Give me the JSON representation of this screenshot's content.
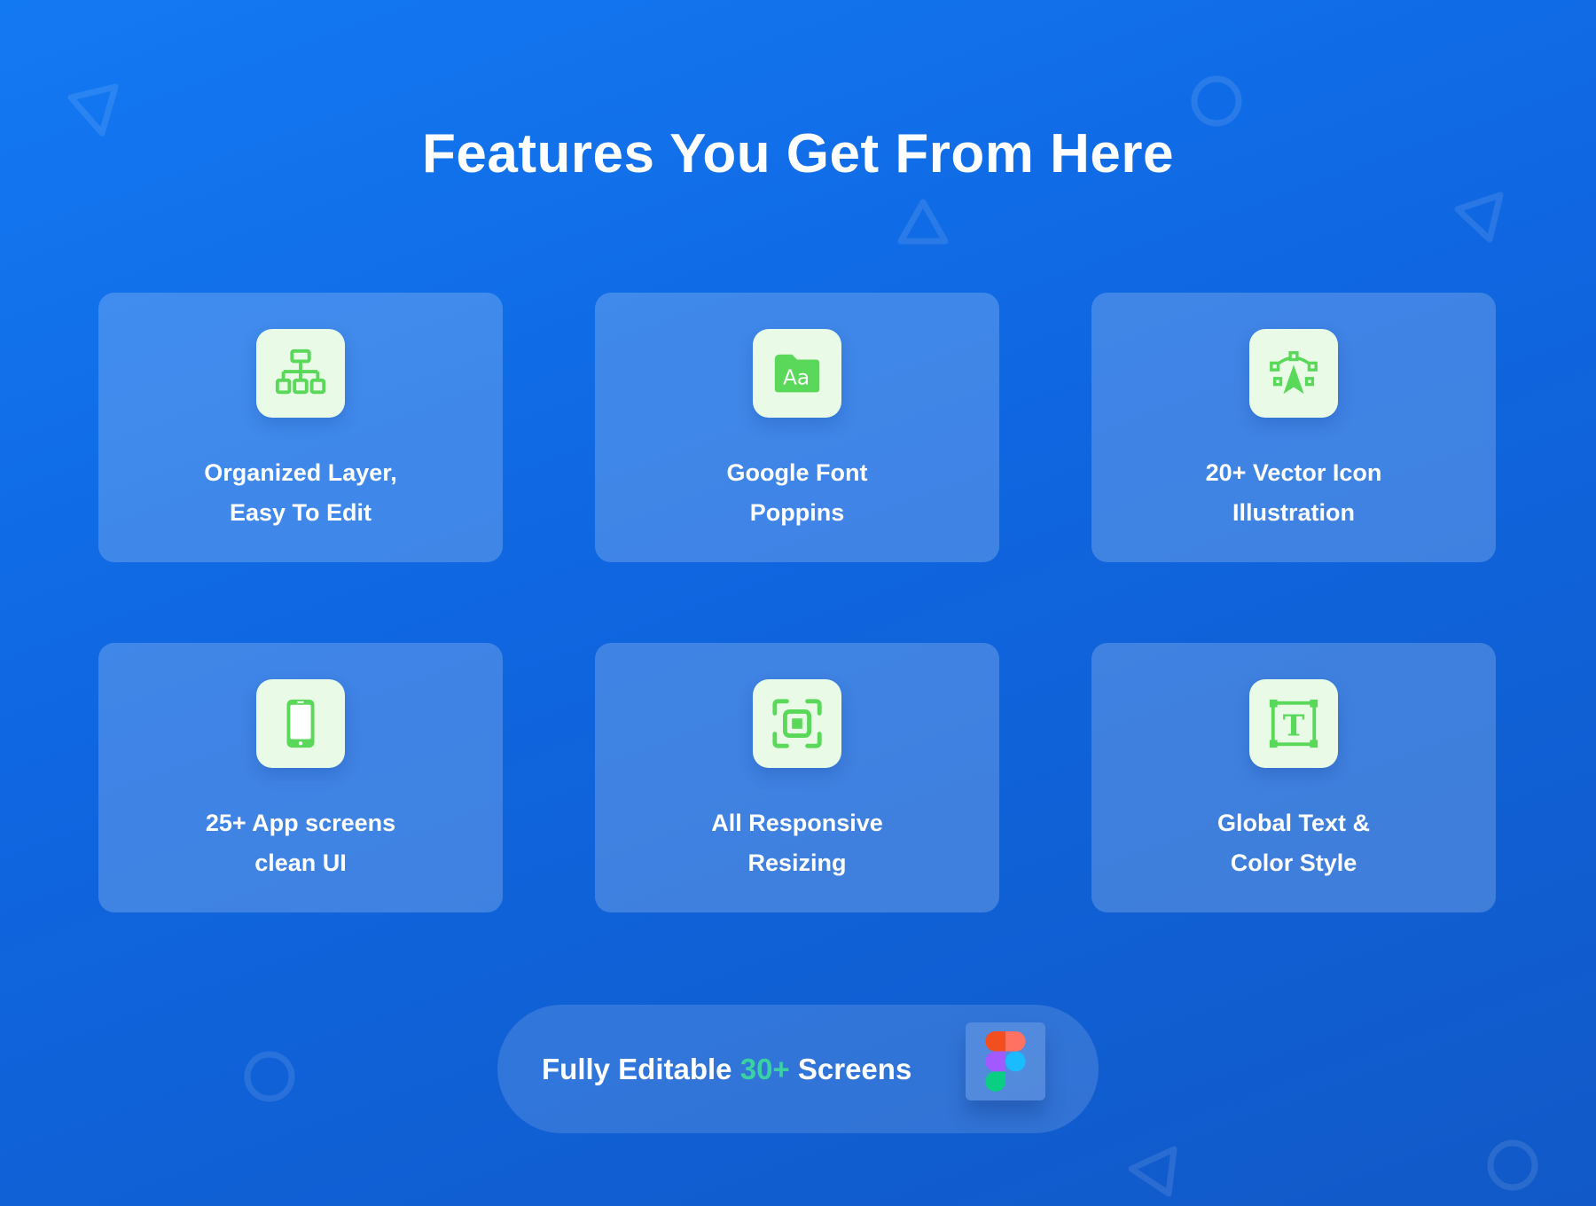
{
  "page": {
    "title": "Features You Get From Here"
  },
  "features": [
    {
      "icon": "sitemap-icon",
      "line1": "Organized Layer,",
      "line2": "Easy To Edit"
    },
    {
      "icon": "font-folder-icon",
      "line1": "Google Font",
      "line2": "Poppins",
      "icon_text": "Aa"
    },
    {
      "icon": "vector-pen-icon",
      "line1": "20+ Vector Icon",
      "line2": "Illustration"
    },
    {
      "icon": "smartphone-icon",
      "line1": "25+ App screens",
      "line2": "clean UI"
    },
    {
      "icon": "resize-icon",
      "line1": "All Responsive",
      "line2": "Resizing"
    },
    {
      "icon": "text-style-icon",
      "line1": "Global Text &",
      "line2": "Color Style",
      "icon_text": "T"
    }
  ],
  "cta": {
    "prefix": "Fully Editable",
    "highlight": "30+",
    "suffix": "Screens",
    "icon": "figma-logo-icon"
  },
  "colors": {
    "background": "#1070ea",
    "icon_green": "#5ad85a",
    "icon_tile": "#e9fbe6",
    "accent": "#3ad2a0",
    "figma_red": "#f24e1e",
    "figma_orange": "#ff7262",
    "figma_purple": "#a259ff",
    "figma_blue": "#1abcfe",
    "figma_green": "#0acf83"
  }
}
